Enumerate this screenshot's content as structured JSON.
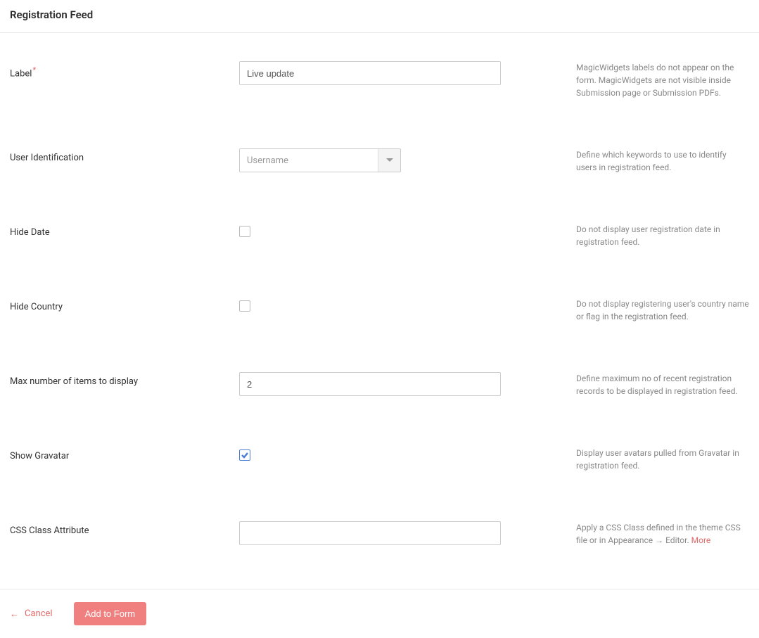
{
  "header": {
    "title": "Registration Feed"
  },
  "fields": {
    "label": {
      "label": "Label",
      "required": true,
      "value": "Live update",
      "help": "MagicWidgets labels do not appear on the form. MagicWidgets are not visible inside Submission page or Submission PDFs."
    },
    "user_id": {
      "label": "User Identification",
      "value": "Username",
      "help": "Define which keywords to use to identify users in registration feed."
    },
    "hide_date": {
      "label": "Hide Date",
      "checked": false,
      "help": "Do not display user registration date in registration feed."
    },
    "hide_country": {
      "label": "Hide Country",
      "checked": false,
      "help": "Do not display registering user's country name or flag in the registration feed."
    },
    "max_items": {
      "label": "Max number of items to display",
      "value": "2",
      "help": "Define maximum no of recent registration records to be displayed in registration feed."
    },
    "gravatar": {
      "label": "Show Gravatar",
      "checked": true,
      "help": "Display user avatars pulled from Gravatar in registration feed."
    },
    "css_class": {
      "label": "CSS Class Attribute",
      "value": "",
      "help": "Apply a CSS Class defined in the theme CSS file or in Appearance → Editor. ",
      "more": "More"
    }
  },
  "footer": {
    "cancel": "Cancel",
    "submit": "Add to Form"
  }
}
